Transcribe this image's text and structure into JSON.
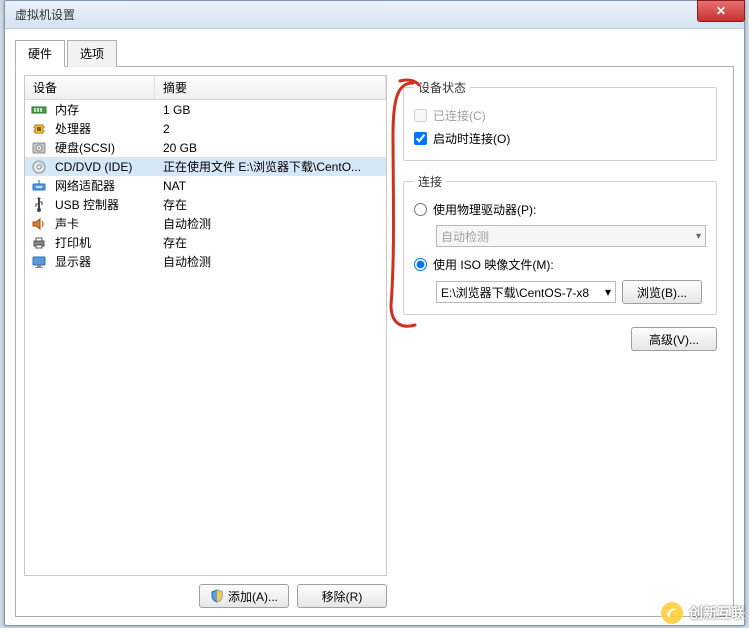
{
  "window": {
    "title": "虚拟机设置"
  },
  "tabs": {
    "hardware": "硬件",
    "options": "选项"
  },
  "columns": {
    "device": "设备",
    "summary": "摘要"
  },
  "devices": [
    {
      "name": "内存",
      "summary": "1 GB",
      "icon": "memory"
    },
    {
      "name": "处理器",
      "summary": "2",
      "icon": "cpu"
    },
    {
      "name": "硬盘(SCSI)",
      "summary": "20 GB",
      "icon": "disk"
    },
    {
      "name": "CD/DVD (IDE)",
      "summary": "正在使用文件 E:\\浏览器下载\\CentO...",
      "icon": "cd",
      "selected": true
    },
    {
      "name": "网络适配器",
      "summary": "NAT",
      "icon": "net"
    },
    {
      "name": "USB 控制器",
      "summary": "存在",
      "icon": "usb"
    },
    {
      "name": "声卡",
      "summary": "自动检测",
      "icon": "sound"
    },
    {
      "name": "打印机",
      "summary": "存在",
      "icon": "printer"
    },
    {
      "name": "显示器",
      "summary": "自动检测",
      "icon": "display"
    }
  ],
  "buttons": {
    "add": "添加(A)...",
    "remove": "移除(R)"
  },
  "status": {
    "legend": "设备状态",
    "connected": "已连接(C)",
    "connect_at_power_on": "启动时连接(O)"
  },
  "connection": {
    "legend": "连接",
    "use_physical": "使用物理驱动器(P):",
    "physical_value": "自动检测",
    "use_iso": "使用 ISO 映像文件(M):",
    "iso_path": "E:\\浏览器下载\\CentOS-7-x8",
    "browse": "浏览(B)..."
  },
  "advanced": "高级(V)...",
  "watermark": "创新互联"
}
